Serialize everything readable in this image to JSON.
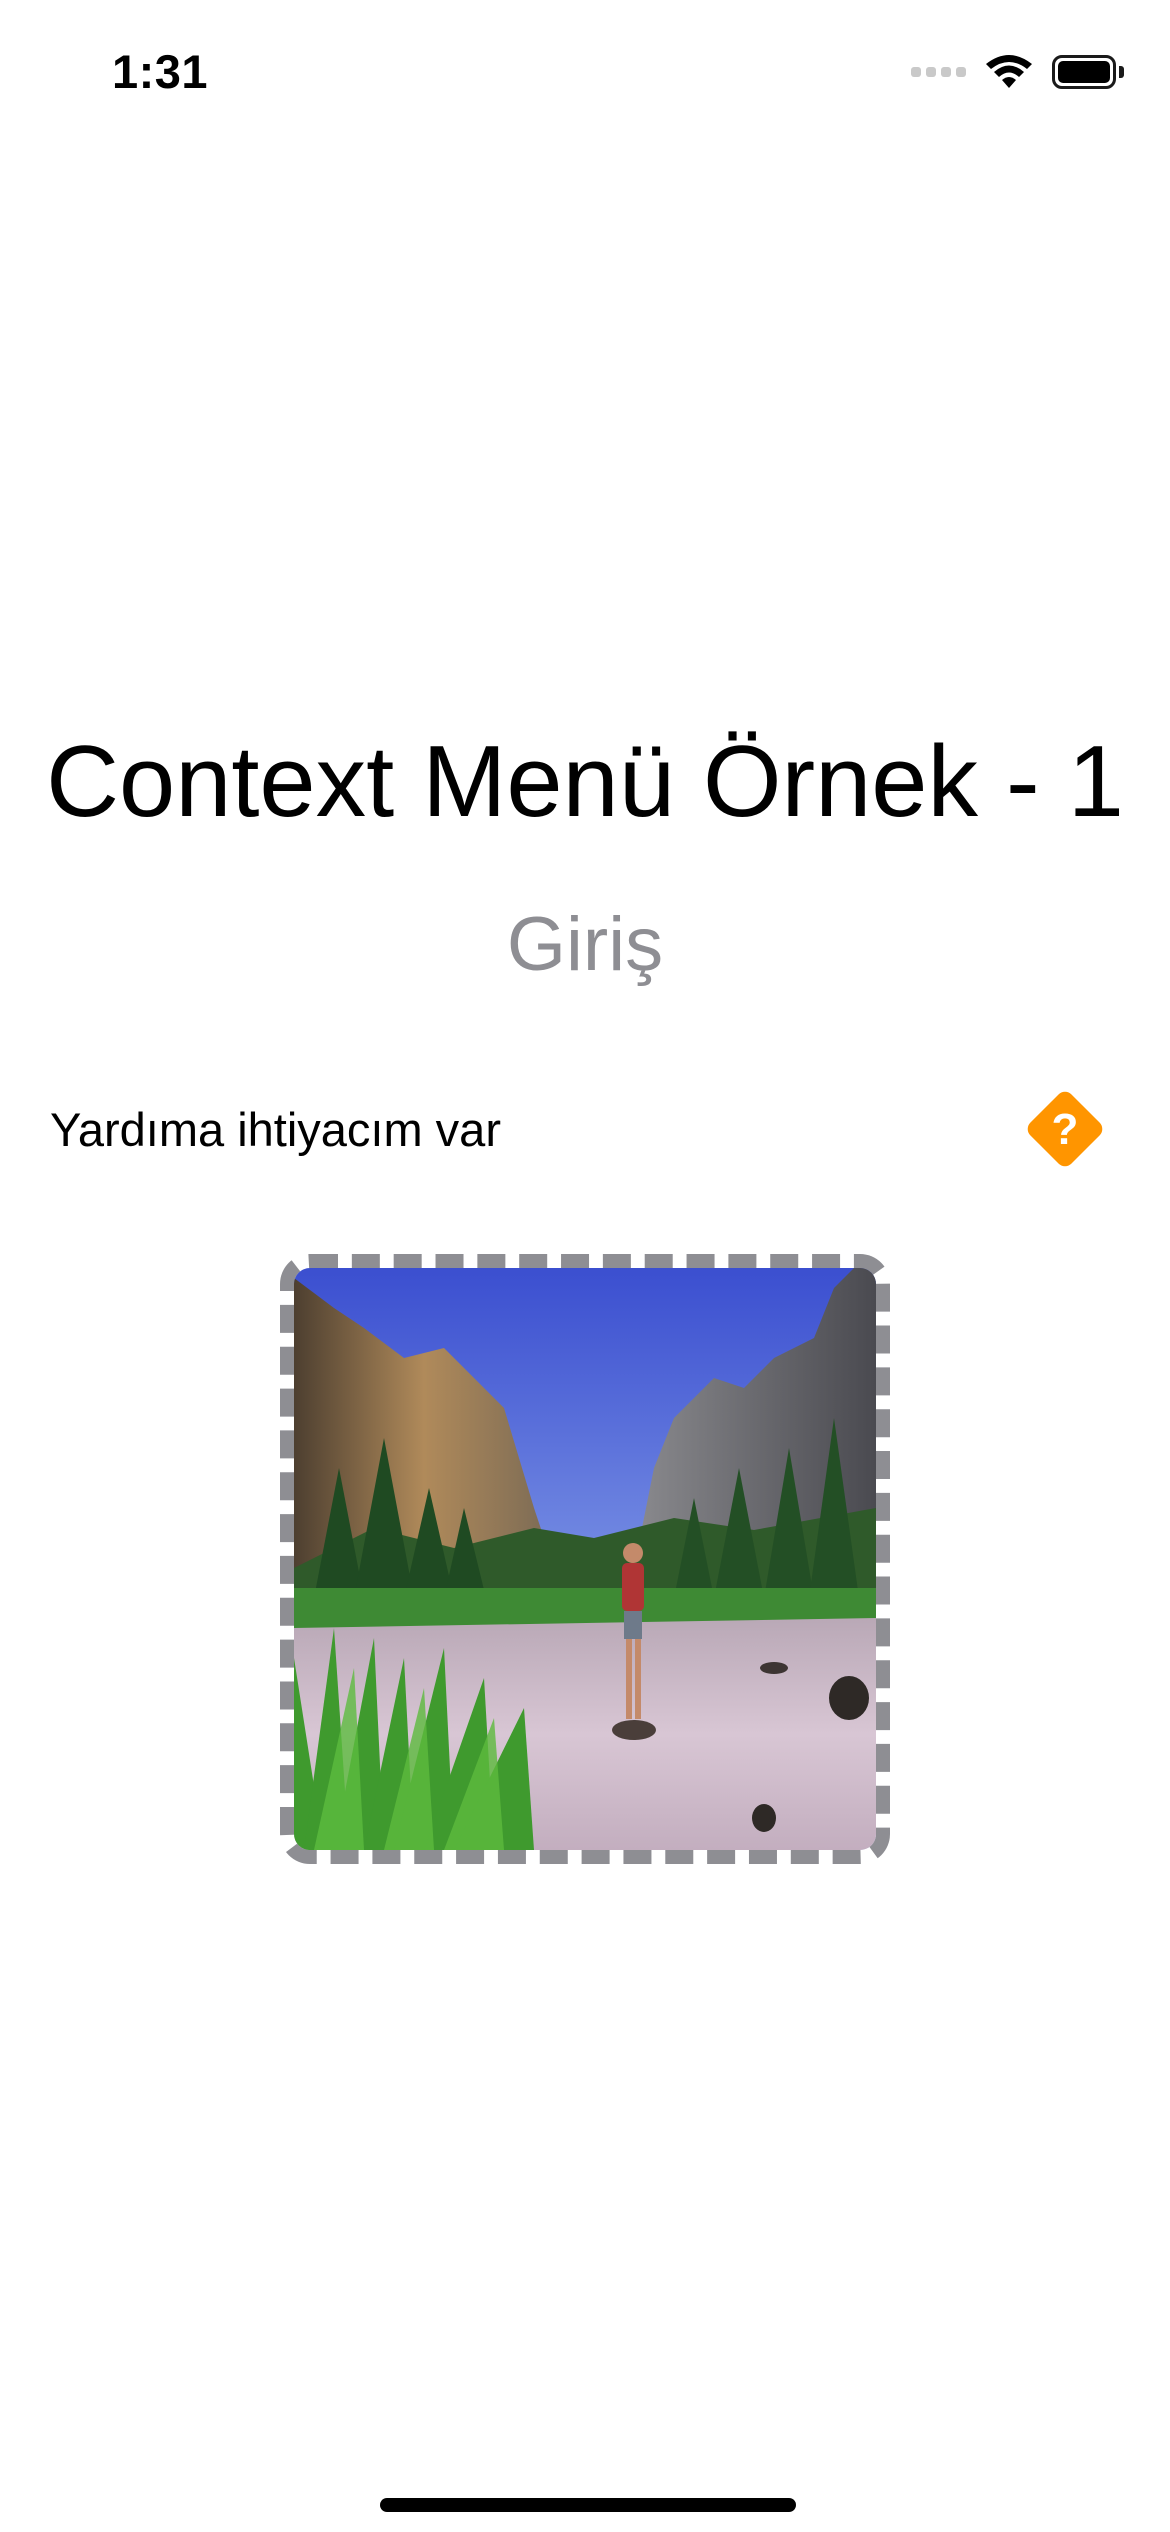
{
  "status_bar": {
    "time": "1:31",
    "signal_icon": "cellular-signal-icon",
    "wifi_icon": "wifi-icon",
    "battery_icon": "battery-icon"
  },
  "screen": {
    "title": "Context Menü Örnek - 1",
    "subtitle": "Giriş",
    "help_label": "Yardıma ihtiyacım var",
    "help_icon": "question-diamond-icon",
    "help_icon_color": "#FF9500",
    "photo_icon": "landscape-photo"
  },
  "colors": {
    "title": "#000000",
    "subtitle": "#8E8E93",
    "frame_border": "#8E8E93",
    "background": "#FFFFFF"
  }
}
